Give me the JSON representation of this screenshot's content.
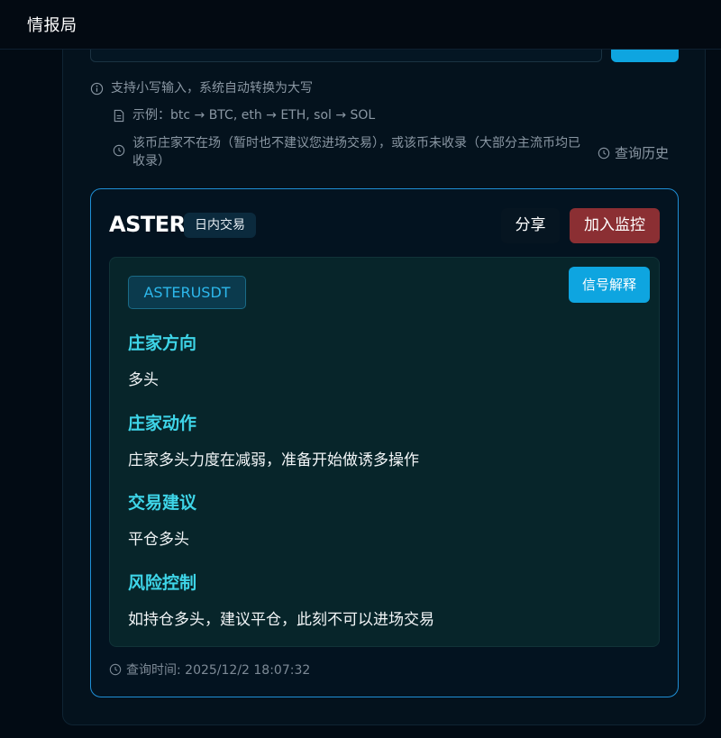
{
  "header": {
    "title": "情报局"
  },
  "hints": {
    "lowercase": "支持小写输入，系统自动转换为大写",
    "example": "示例：btc → BTC, eth → ETH, sol → SOL",
    "warning": "该币庄家不在场（暂时也不建议您进场交易），或该币未收录（大部分主流币均已收录）"
  },
  "history_label": "查询历史",
  "result": {
    "coin": "ASTER",
    "badge": "日内交易",
    "share_label": "分享",
    "monitor_label": "加入监控",
    "symbol": "ASTERUSDT",
    "explain_label": "信号解释",
    "sections": [
      {
        "title": "庄家方向",
        "body": "多头"
      },
      {
        "title": "庄家动作",
        "body": "庄家多头力度在减弱，准备开始做诱多操作"
      },
      {
        "title": "交易建议",
        "body": "平仓多头"
      },
      {
        "title": "风险控制",
        "body": "如持仓多头，建议平仓，此刻不可以进场交易"
      }
    ],
    "query_time": "查询时间: 2025/12/2 18:07:32"
  }
}
